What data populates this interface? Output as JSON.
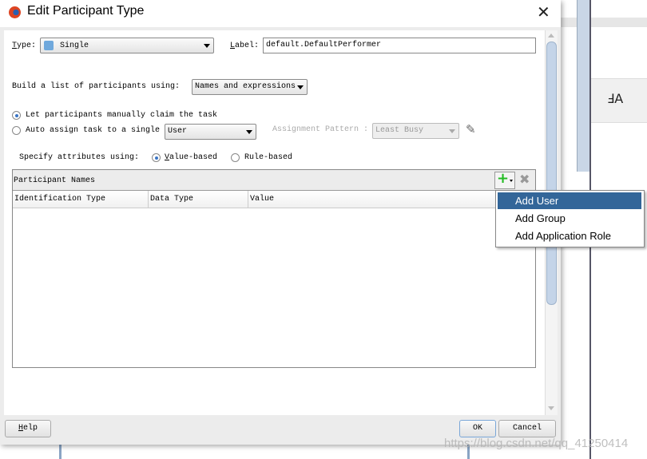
{
  "dialog": {
    "title": "Edit Participant Type",
    "close_icon": "close-icon"
  },
  "type": {
    "label": "Type:",
    "value": "Single",
    "icon": "user-icon"
  },
  "label_field": {
    "label": "Label:",
    "value": "default.DefaultPerformer"
  },
  "build": {
    "label": "Build a list of participants using:",
    "value": "Names and expressions"
  },
  "assignment": {
    "manual": "Let participants manually claim the task",
    "manual_selected": true,
    "auto": "Auto assign task to a single",
    "auto_value": "User",
    "pattern_label": "Assignment Pattern :",
    "pattern_value": "Least Busy"
  },
  "attributes": {
    "label": "Specify attributes using:",
    "value_based": "Value-based",
    "rule_based": "Rule-based",
    "selected": "Value-based"
  },
  "table": {
    "title": "Participant Names",
    "columns": [
      "Identification Type",
      "Data Type",
      "Value"
    ],
    "rows": []
  },
  "menu": {
    "items": [
      "Add User",
      "Add Group",
      "Add Application Role"
    ],
    "highlighted": "Add User",
    "highlight_color": "#336699"
  },
  "footer": {
    "help": "Help",
    "ok": "OK",
    "cancel": "Cancel"
  },
  "watermark": "https://blog.csdn.net/qq_41250414"
}
